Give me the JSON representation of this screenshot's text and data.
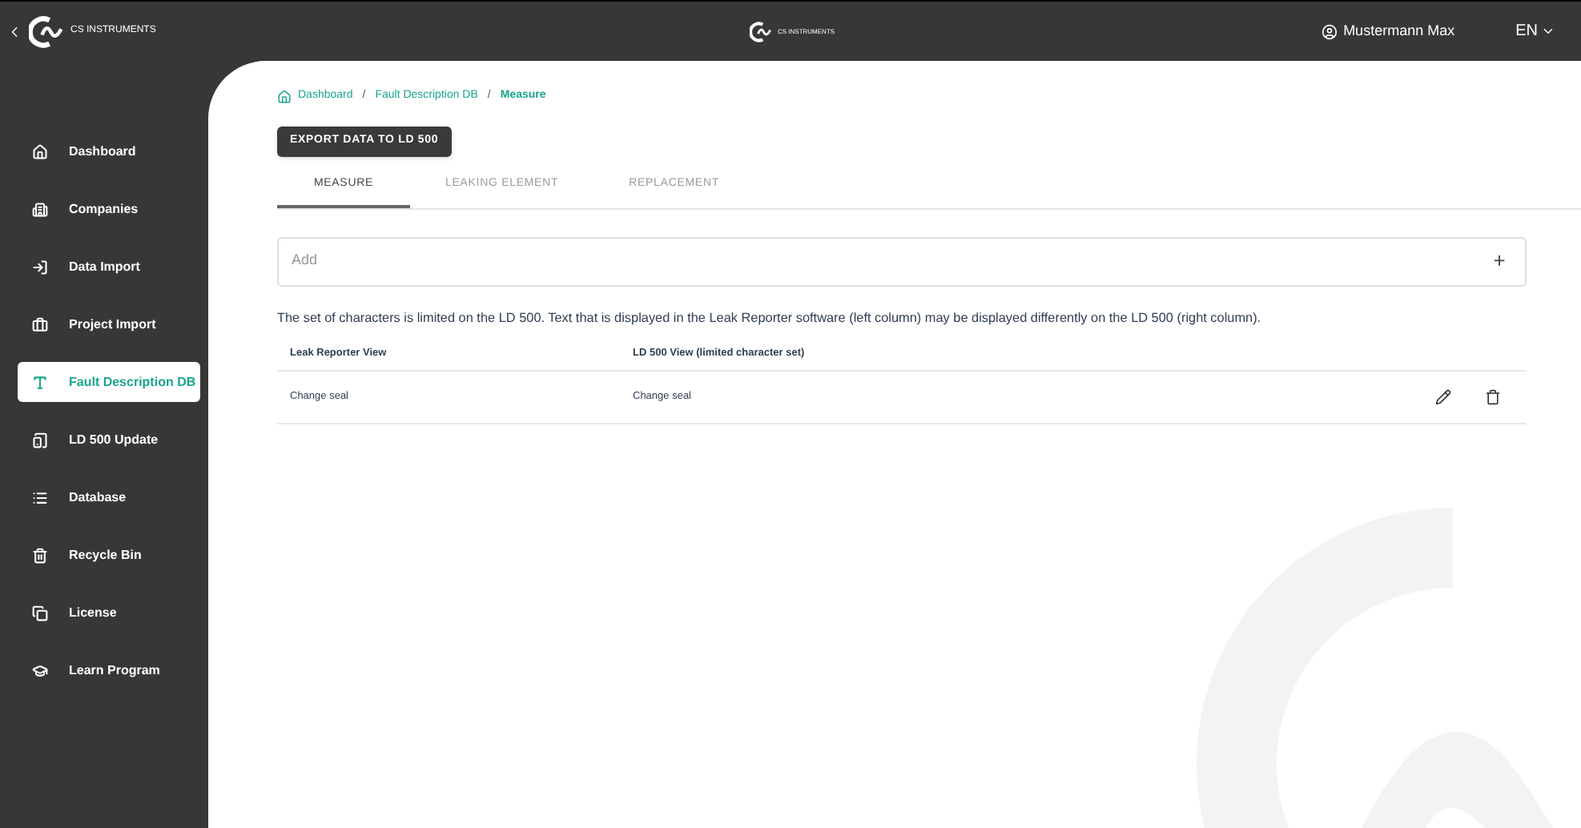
{
  "sidebar": {
    "brand": "CS INSTRUMENTS",
    "items": [
      {
        "label": "Dashboard",
        "selected": false
      },
      {
        "label": "Companies",
        "selected": false
      },
      {
        "label": "Data Import",
        "selected": false
      },
      {
        "label": "Project Import",
        "selected": false
      },
      {
        "label": "Fault Description DB",
        "selected": true
      },
      {
        "label": "LD 500 Update",
        "selected": false
      },
      {
        "label": "Database",
        "selected": false
      },
      {
        "label": "Recycle Bin",
        "selected": false
      },
      {
        "label": "License",
        "selected": false
      },
      {
        "label": "Learn Program",
        "selected": false
      }
    ]
  },
  "topbar": {
    "brand": "CS INSTRUMENTS",
    "user": "Mustermann Max",
    "language": "EN"
  },
  "breadcrumb": {
    "items": [
      "Dashboard",
      "Fault Description DB",
      "Measure"
    ],
    "separators": [
      "/",
      "/"
    ]
  },
  "export_button": "EXPORT DATA TO LD 500",
  "tabs": [
    {
      "label": "MEASURE",
      "selected": true
    },
    {
      "label": "LEAKING ELEMENT",
      "selected": false
    },
    {
      "label": "REPLACEMENT",
      "selected": false
    }
  ],
  "add_field": {
    "placeholder": "Add",
    "button": "+"
  },
  "note": "The set of characters is limited on the LD 500. Text that is displayed in the Leak Reporter software (left column) may be displayed differently on the LD 500 (right column).",
  "table": {
    "columns": [
      "Leak Reporter View",
      "LD 500 View (limited character set)"
    ],
    "rows": [
      [
        "Change seal",
        "Change seal"
      ]
    ]
  }
}
